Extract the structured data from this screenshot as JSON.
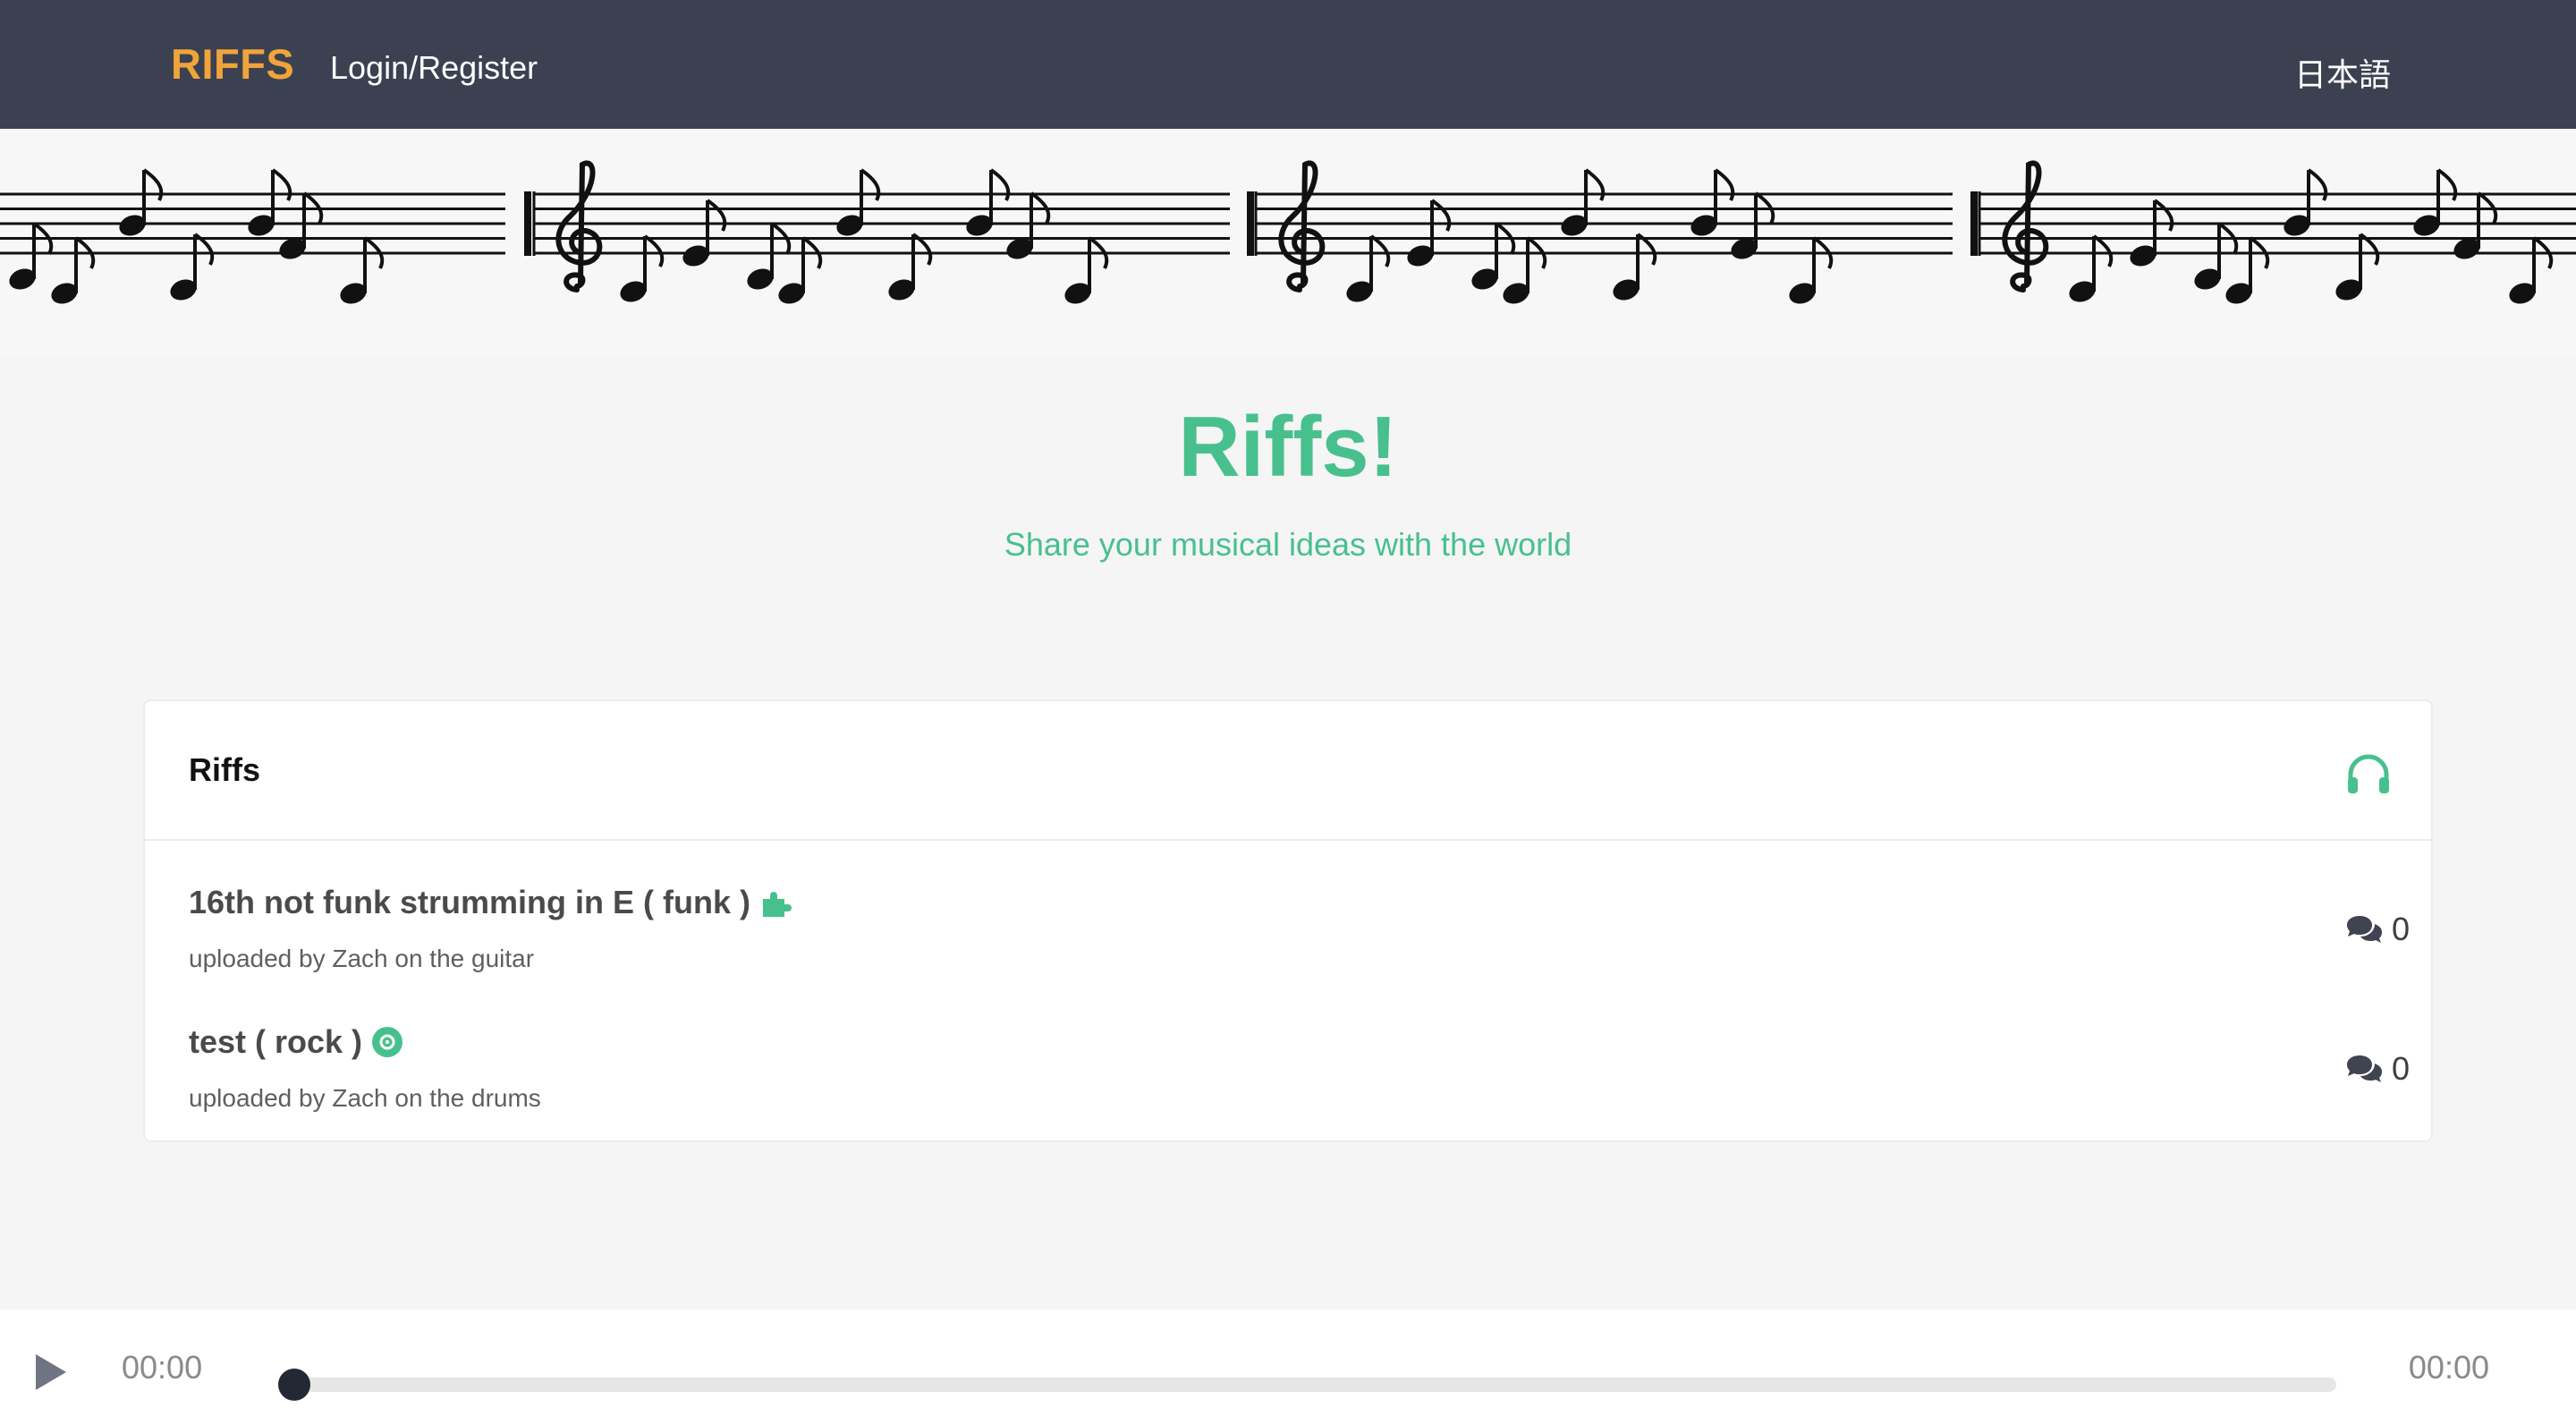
{
  "navbar": {
    "brand": "RIFFS",
    "login_label": "Login/Register",
    "language_label": "日本語"
  },
  "hero": {
    "title": "Riffs!",
    "subtitle": "Share your musical ideas with the world"
  },
  "riffs_card": {
    "title": "Riffs",
    "header_icon": "headphones-icon",
    "items": [
      {
        "title": "16th not funk strumming in E ( funk )",
        "icon": "puzzle-icon",
        "meta": "uploaded by Zach on the guitar",
        "comment_count": "0"
      },
      {
        "title": "test ( rock )",
        "icon": "record-icon",
        "meta": "uploaded by Zach on the drums",
        "comment_count": "0"
      }
    ]
  },
  "player": {
    "current_time": "00:00",
    "total_time": "00:00",
    "progress": 0
  },
  "colors": {
    "navbar_bg": "#3b4151",
    "brand": "#f0a43a",
    "accent_green": "#48c08e",
    "page_bg": "#f5f5f5"
  }
}
